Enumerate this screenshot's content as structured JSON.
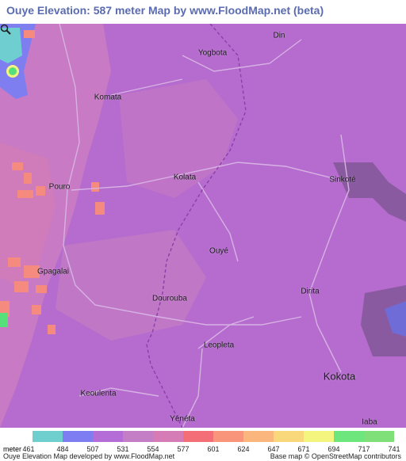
{
  "title": "Ouye Elevation: 587 meter Map by www.FloodMap.net (beta)",
  "map": {
    "places": [
      {
        "name": "Din",
        "class": "normal"
      },
      {
        "name": "Yogbota",
        "class": "normal"
      },
      {
        "name": "Komata",
        "class": "normal"
      },
      {
        "name": "Kolata",
        "class": "normal"
      },
      {
        "name": "Sinkoté",
        "class": "normal"
      },
      {
        "name": "Pouro",
        "class": "normal"
      },
      {
        "name": "Ouyé",
        "class": "normal"
      },
      {
        "name": "Gpagalai",
        "class": "normal"
      },
      {
        "name": "Dourouba",
        "class": "normal"
      },
      {
        "name": "Dirita",
        "class": "normal"
      },
      {
        "name": "Leopleta",
        "class": "normal"
      },
      {
        "name": "Kokota",
        "class": "big"
      },
      {
        "name": "Keoulenta",
        "class": "normal"
      },
      {
        "name": "Yénéta",
        "class": "normal"
      },
      {
        "name": "Iaba",
        "class": "normal"
      }
    ],
    "colors": {
      "base": "#b56cce",
      "high": "#cc73b8",
      "orange": "#f58a7e",
      "green": "#55e07a",
      "cyan": "#6fcfd0",
      "blue": "#7e7ef0",
      "road_light": "#d7b2e3",
      "border": "#8a3fa8"
    },
    "zoom_icon": "magnifier-icon"
  },
  "legend": {
    "unit_label": "meter",
    "colors": [
      "#6fcfcf",
      "#7e7ef2",
      "#b46dd6",
      "#c47ec6",
      "#d57bb6",
      "#f46e78",
      "#f8957a",
      "#fbb67e",
      "#f8d87a",
      "#f4f57e",
      "#6ee67e",
      "#7fe07a"
    ],
    "ticks": [
      "461",
      "484",
      "507",
      "531",
      "554",
      "577",
      "601",
      "624",
      "647",
      "671",
      "694",
      "717",
      "741"
    ]
  },
  "footer": {
    "left": "Ouye Elevation Map developed by www.FloodMap.net",
    "right": "Base map © OpenStreetMap contributors"
  }
}
